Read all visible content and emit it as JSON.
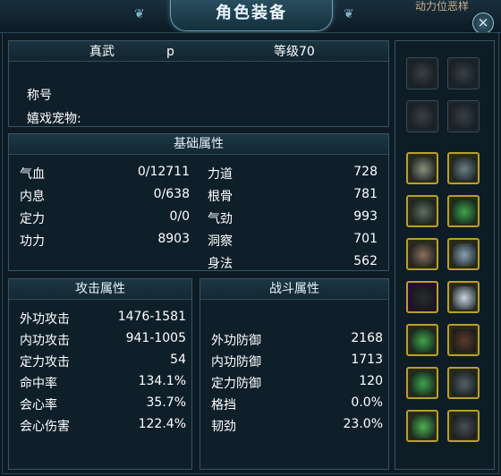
{
  "window": {
    "title": "角色装备",
    "close_icon": "×",
    "corner_text": "动力位恶样"
  },
  "character": {
    "name": "真武",
    "tag": "p",
    "level": "等级70",
    "title_label": "称号",
    "pet_label": "嬉戏宠物:"
  },
  "basic": {
    "title": "基础属性",
    "left": [
      {
        "label": "气血",
        "value": "0/12711"
      },
      {
        "label": "内息",
        "value": "0/638"
      },
      {
        "label": "定力",
        "value": "0/0"
      },
      {
        "label": "功力",
        "value": "8903"
      }
    ],
    "right": [
      {
        "label": "力道",
        "value": "728"
      },
      {
        "label": "根骨",
        "value": "781"
      },
      {
        "label": "气劲",
        "value": "993"
      },
      {
        "label": "洞察",
        "value": "701"
      },
      {
        "label": "身法",
        "value": "562"
      }
    ]
  },
  "attack": {
    "title": "攻击属性",
    "rows": [
      {
        "label": "外功攻击",
        "value": "1476-1581"
      },
      {
        "label": "内功攻击",
        "value": "941-1005"
      },
      {
        "label": "定力攻击",
        "value": "54"
      },
      {
        "label": "命中率",
        "value": "134.1%"
      },
      {
        "label": "会心率",
        "value": "35.7%"
      },
      {
        "label": "会心伤害",
        "value": "122.4%"
      }
    ]
  },
  "battle": {
    "title": "战斗属性",
    "rows": [
      {
        "label": "外功防御",
        "value": "2168"
      },
      {
        "label": "内功防御",
        "value": "1713"
      },
      {
        "label": "定力防御",
        "value": "120"
      },
      {
        "label": "格挡",
        "value": "0.0%"
      },
      {
        "label": "韧劲",
        "value": "23.0%"
      }
    ]
  },
  "equipment": {
    "slots": [
      {
        "name": "empty-armor-icon",
        "color": "#4a5358"
      },
      {
        "name": "empty-hidden-weapon-icon",
        "color": "#4a5358"
      },
      {
        "name": "empty-mask-icon",
        "color": "#4a5358"
      },
      {
        "name": "empty-glove-icon",
        "color": "#4a5358"
      },
      {
        "name": "sword-icon",
        "color": "#8a8f7a"
      },
      {
        "name": "armor-suit-icon",
        "color": "#6c7f86"
      },
      {
        "name": "blade-icon",
        "color": "#5d6e5a"
      },
      {
        "name": "jade-pendant-icon",
        "color": "#3fa24a"
      },
      {
        "name": "crossbow-icon",
        "color": "#8a6f5a"
      },
      {
        "name": "cloak-icon",
        "color": "#8aa0b0"
      },
      {
        "name": "horse-icon",
        "color": "#2a2a2a"
      },
      {
        "name": "trousers-icon",
        "color": "#c7d6e0"
      },
      {
        "name": "ring-icon",
        "color": "#3fa24a"
      },
      {
        "name": "bracer-icon",
        "color": "#5a3a2a"
      },
      {
        "name": "ring-2-icon",
        "color": "#3fa24a"
      },
      {
        "name": "robe-icon",
        "color": "#56606a"
      },
      {
        "name": "bracelet-icon",
        "color": "#4fb050"
      },
      {
        "name": "boots-icon",
        "color": "#4a4f55"
      }
    ]
  }
}
